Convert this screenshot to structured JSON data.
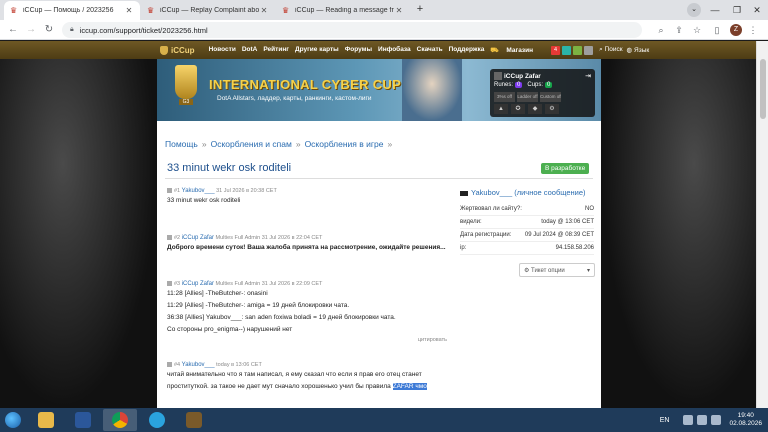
{
  "browser": {
    "tabs": [
      {
        "title": "iCCup — Помощь / 2023256",
        "active": true
      },
      {
        "title": "iCCup — Replay Complaint abou",
        "active": false
      },
      {
        "title": "iCCup — Reading a message fro",
        "active": false
      }
    ],
    "url": "iccup.com/support/ticket/2023256.html",
    "profile_initial": "Z"
  },
  "site": {
    "logo": "iCCup",
    "menu": [
      "Новости",
      "DotA",
      "Рейтинг",
      "Другие карты",
      "Форумы",
      "Инфобаза",
      "Скачать",
      "Поддержка",
      "Магазин"
    ],
    "notif_count": "4",
    "search_label": "Поиск",
    "lang_label": "Язык"
  },
  "banner": {
    "title": "INTERNATIONAL CYBER CUP",
    "subtitle": "DotA Allstars, ладдер, карты, ранкинги, кастом-лиги",
    "trophy_label": "G3"
  },
  "user_box": {
    "name": "iCCup Zafar",
    "runes_label": "Runes:",
    "runes_value": "0",
    "cups_label": "Cups:",
    "cups_value": "0",
    "tiles": [
      "3%s off",
      "Ladder off",
      "Custom off"
    ]
  },
  "breadcrumbs": [
    "Помощь",
    "Оскорбления и спам",
    "Оскорбления в игре"
  ],
  "ticket": {
    "title": "33 minut wekr osk roditeli",
    "status": "В разработке"
  },
  "posts": [
    {
      "num": "#1",
      "author": "Yakubov___",
      "role": "",
      "date": "31 Jul 2026 в 20:38 CET",
      "lines": [
        "33 minut wekr osk roditeli"
      ]
    },
    {
      "num": "#2",
      "author": "iCCup Zafar",
      "role": "Multies Full Admin",
      "date": "31 Jul 2026 в 22:04 CET",
      "lines": [
        "Доброго времени суток! Ваша жалоба принята на рассмотрение, ожидайте решения..."
      ]
    },
    {
      "num": "#3",
      "author": "iCCup Zafar",
      "role": "Multies Full Admin",
      "date": "31 Jul 2026 в 22:09 CET",
      "lines": [
        "11:28 [Allies] -TheButcher-: onasini",
        "11:29 [Allies] -TheButcher-: amiga = 19 дней блокировки чата.",
        "36:38 [Allies] Yakubov___: san aden foxiwa boladi = 19 дней блокировки чата.",
        "Со стороны pro_enigma--) нарушений нет"
      ],
      "quote": "цитировать"
    },
    {
      "num": "#4",
      "author": "Yakubov___",
      "role": "",
      "date": "today в 13:06 CET",
      "lines": [
        "читай внимательно что я там написал, я ему сказал что если я прав его отец станет",
        "проституткой. за такое не дает мут сначало хорошенько учил бы правила "
      ],
      "highlight": "ZAFAR чмо"
    }
  ],
  "side": {
    "user": "Yakubov___ (личное сообщение)",
    "rows": [
      {
        "label": "Жертвовал ли сайту?:",
        "value": "NO"
      },
      {
        "label": "видели:",
        "value": "today @ 13:06 CET"
      },
      {
        "label": "Дата регистрации:",
        "value": "09 Jul 2024 @ 08:39 CET"
      },
      {
        "label": "ip:",
        "value": "94.158.58.206"
      }
    ],
    "options_label": "Тикет опции"
  },
  "taskbar": {
    "lang": "EN",
    "time": "19:40",
    "date": "02.08.2026"
  },
  "colors": {
    "nav_bg": "#5a4519",
    "status_green": "#4caf50",
    "link_blue": "#2a6cb0",
    "taskbar": "#1f3b5a"
  }
}
